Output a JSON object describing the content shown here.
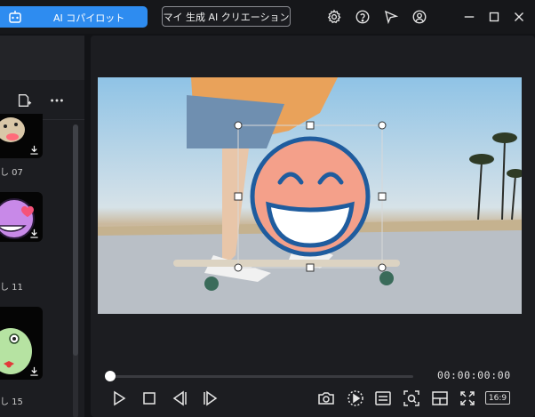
{
  "topbar": {
    "copilot_label": "AI コパイロット",
    "creation_label": "マイ 生成 AI クリエーション",
    "icons": [
      "gear-icon",
      "help-icon",
      "megaphone-icon",
      "account-icon",
      "minimize-icon",
      "maximize-icon",
      "close-icon"
    ]
  },
  "stickers": [
    {
      "label": "し 07",
      "icon": "dog-sticker"
    },
    {
      "label": "し 11",
      "icon": "heart-eye-emoji-sticker"
    },
    {
      "label": "し 15",
      "icon": "frog-sticker"
    }
  ],
  "player": {
    "timecode": "00:00:00:00",
    "aspect_ratio": "16:9",
    "progress": 0,
    "controls": [
      "play-icon",
      "stop-icon",
      "previous-frame-icon",
      "next-frame-icon",
      "snapshot-icon",
      "render-preview-icon",
      "display-settings-icon",
      "zoom-icon",
      "layout-icon",
      "fullscreen-icon"
    ]
  },
  "colors": {
    "accent": "#2e8cf0",
    "emoji_face": "#f4a08a",
    "emoji_outline": "#1f5c9e"
  }
}
